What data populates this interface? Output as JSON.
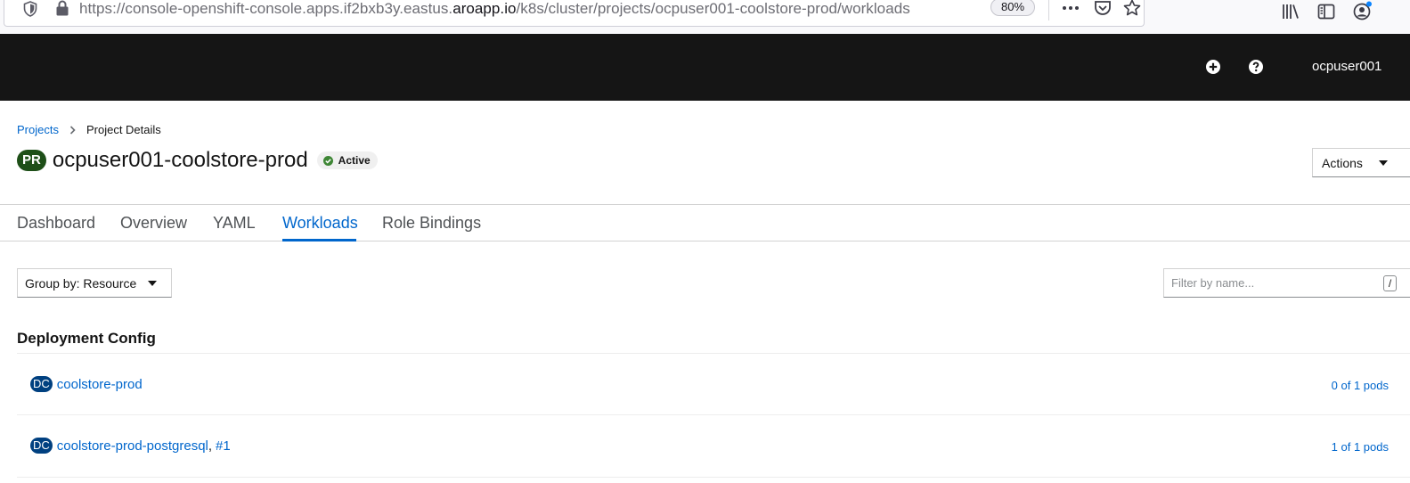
{
  "browser": {
    "url_prefix": "https://console-openshift-console.apps.if2bxb3y.eastus.",
    "url_domain": "aroapp.io",
    "url_path": "/k8s/cluster/projects/ocpuser001-coolstore-prod/workloads",
    "zoom": "80%",
    "icons": [
      "shield-icon",
      "lock-icon",
      "more-icon",
      "pocket-icon",
      "star-icon",
      "library-icon",
      "sidebar-icon",
      "account-icon"
    ]
  },
  "masthead": {
    "username": "ocpuser001",
    "icons": [
      "add-icon",
      "help-icon"
    ],
    "background": "#151515"
  },
  "breadcrumb": {
    "projects": "Projects",
    "current": "Project Details"
  },
  "project": {
    "badge": "PR",
    "name": "ocpuser001-coolstore-prod",
    "status": "Active",
    "actions_label": "Actions"
  },
  "tabs": [
    {
      "label": "Dashboard",
      "active": false
    },
    {
      "label": "Overview",
      "active": false
    },
    {
      "label": "YAML",
      "active": false
    },
    {
      "label": "Workloads",
      "active": true
    },
    {
      "label": "Role Bindings",
      "active": false
    }
  ],
  "toolbar": {
    "group_by": "Group by: Resource",
    "filter_placeholder": "Filter by name...",
    "filter_value": "",
    "shortcut_hint": "/"
  },
  "section": {
    "title": "Deployment Config",
    "items": [
      {
        "badge": "DC",
        "name": "coolstore-prod",
        "suffix_sep": "",
        "suffix": "",
        "pods": "0 of 1 pods"
      },
      {
        "badge": "DC",
        "name": "coolstore-prod-postgresql",
        "suffix_sep": ",",
        "suffix": "#1",
        "pods": "1 of 1 pods"
      }
    ]
  },
  "colors": {
    "link": "#0066cc",
    "status_ok": "#3e8635",
    "project_badge": "#1e4f18",
    "dc_badge": "#004080"
  }
}
